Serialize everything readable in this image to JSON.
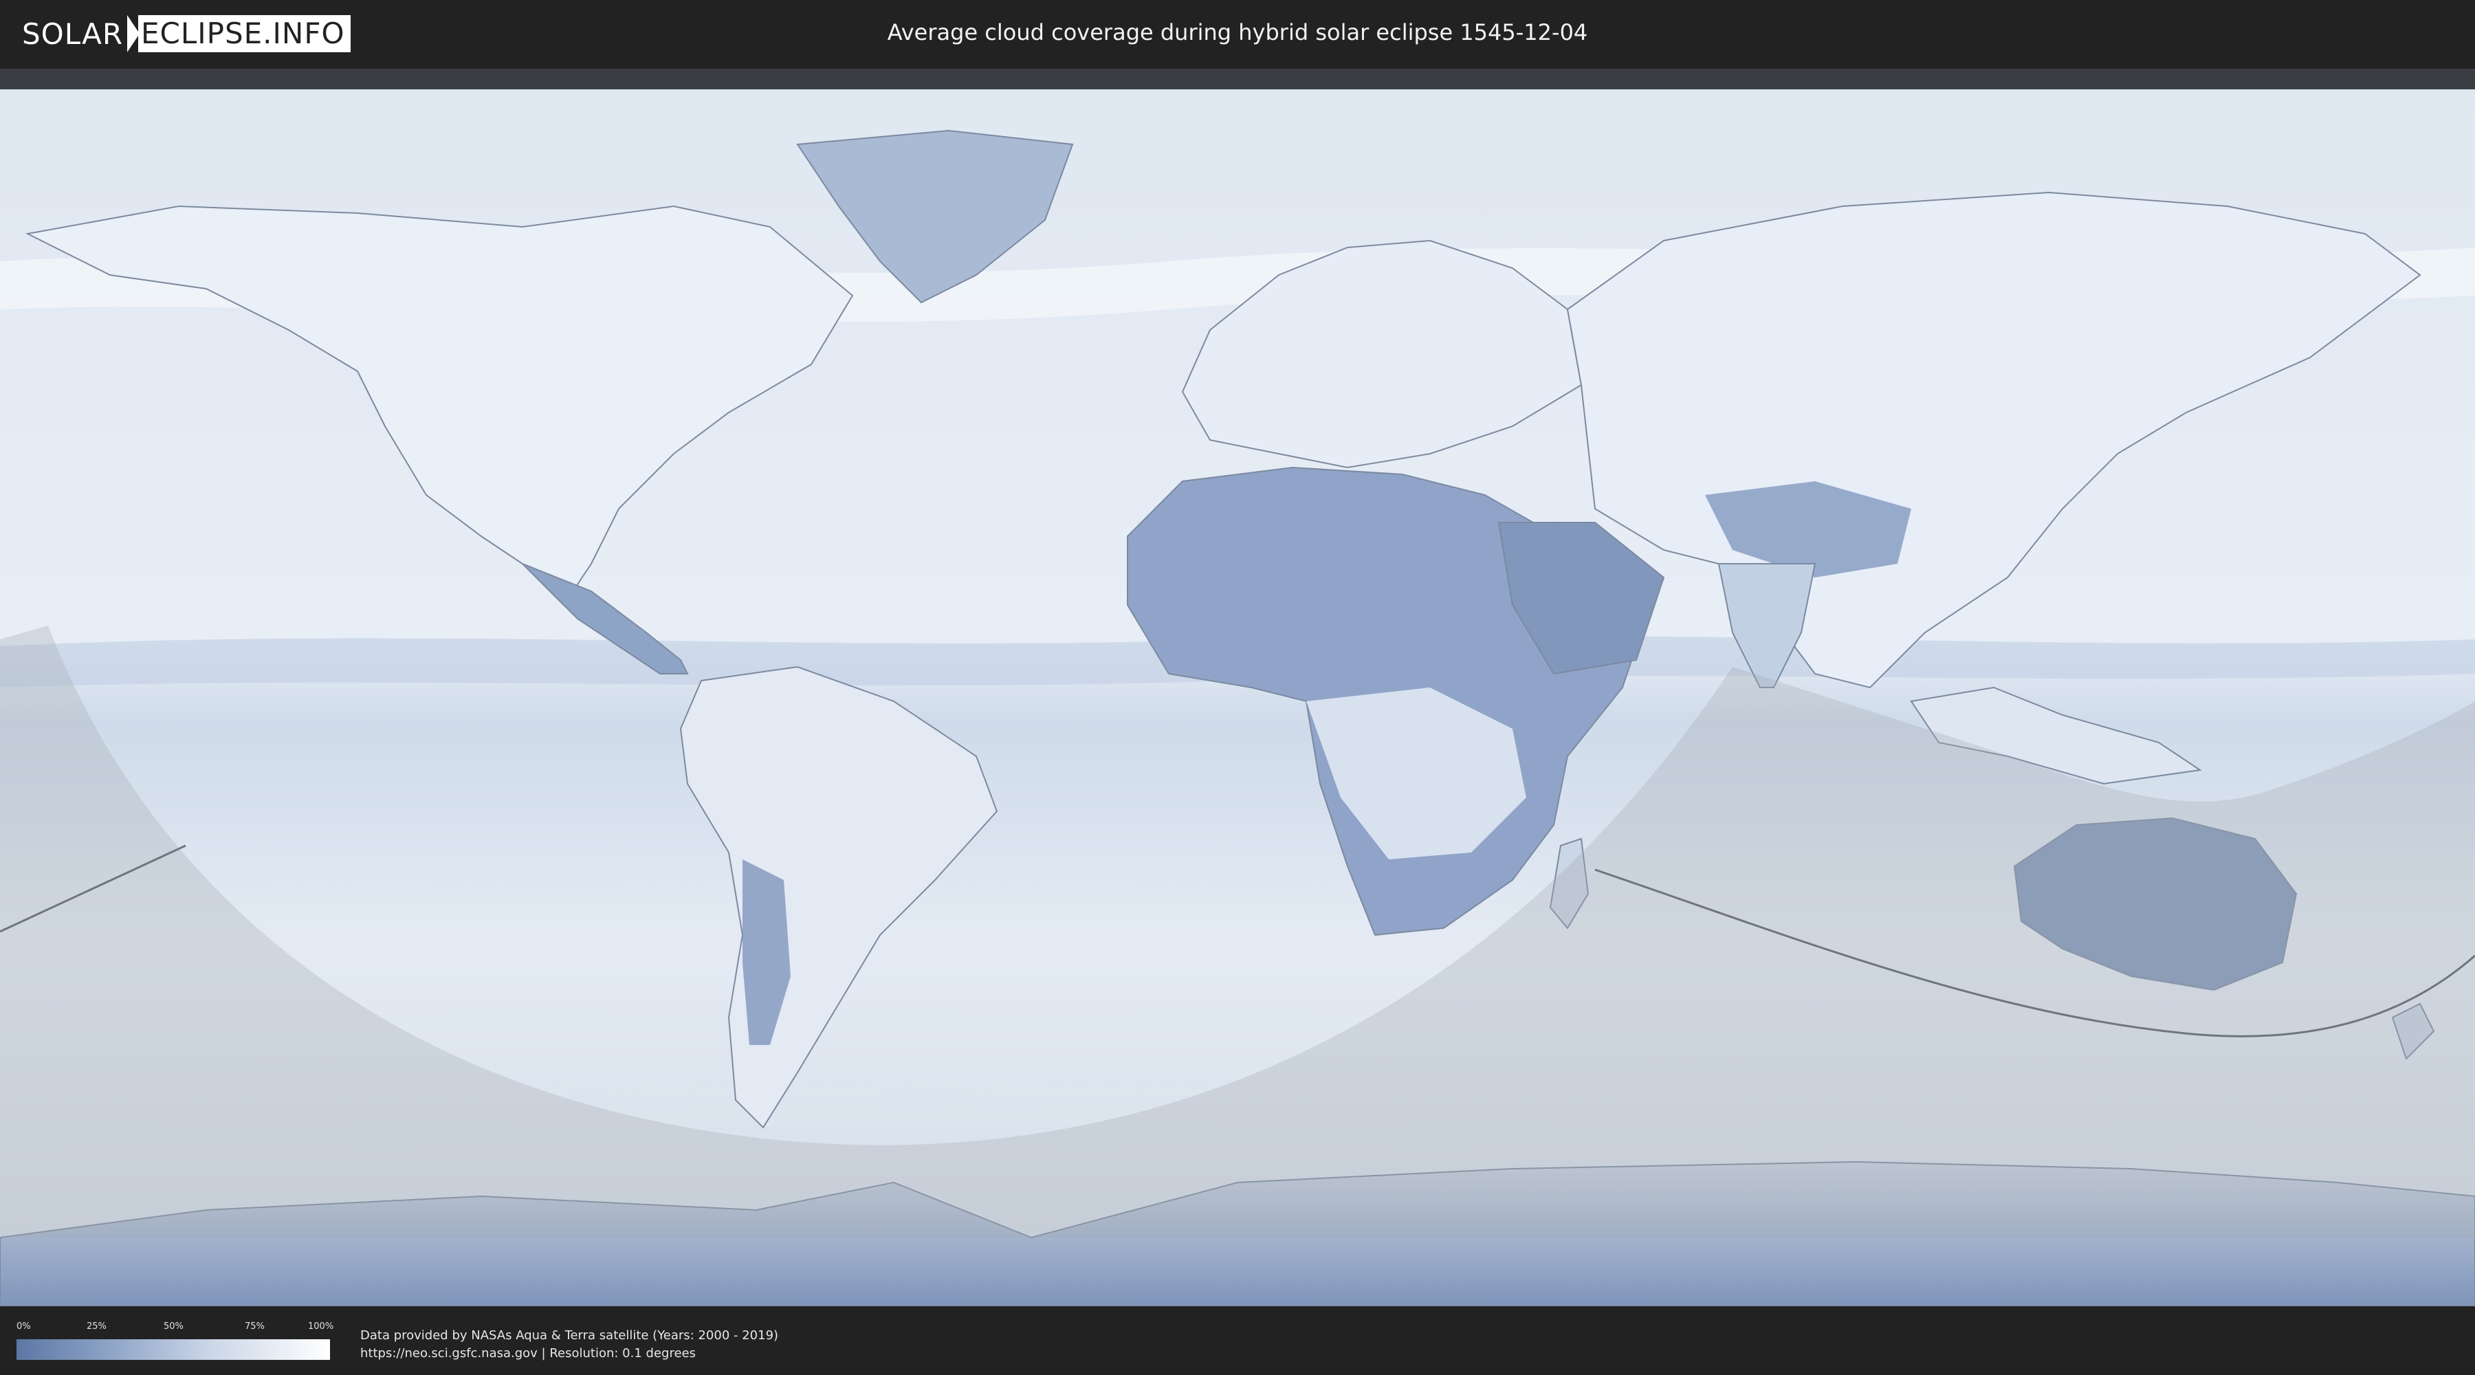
{
  "header": {
    "logo_left": "SOLAR",
    "logo_right": "ECLIPSE.INFO",
    "title": "Average cloud coverage during hybrid solar eclipse 1545-12-04"
  },
  "legend": {
    "ticks": [
      "0%",
      "25%",
      "50%",
      "75%",
      "100%"
    ],
    "colors": {
      "low": "#5c77a5",
      "high": "#ffffff"
    }
  },
  "footer": {
    "line1": "Data provided by NASAs Aqua & Terra satellite (Years: 2000 - 2019)",
    "line2": "https://neo.sci.gsfc.nasa.gov | Resolution: 0.1 degrees"
  },
  "map": {
    "colors": {
      "ocean": "#d9e3ef",
      "land_cloudy": "#eef3f9",
      "land_clear": "#7f96bd",
      "shadow": "#a6acb2",
      "coast": "#7c8aa0"
    }
  }
}
